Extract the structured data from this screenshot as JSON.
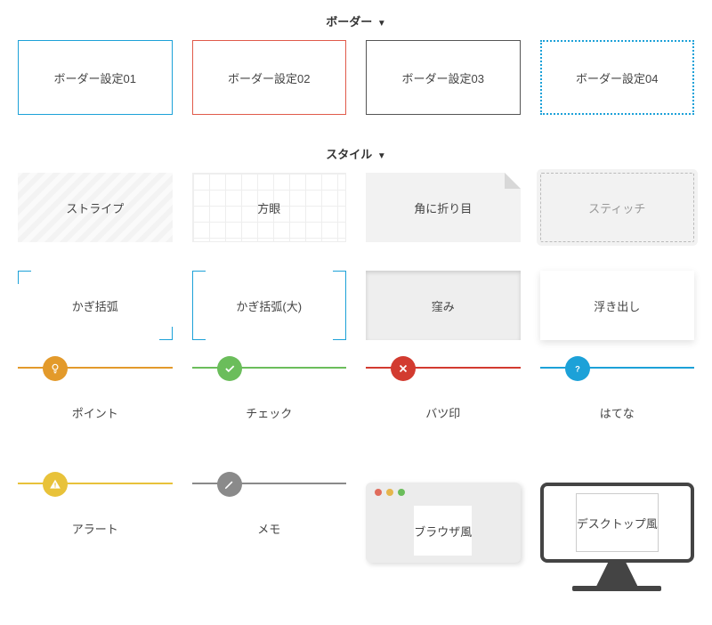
{
  "sections": {
    "border": {
      "title": "ボーダー"
    },
    "style": {
      "title": "スタイル"
    }
  },
  "border_items": [
    "ボーダー設定01",
    "ボーダー設定02",
    "ボーダー設定03",
    "ボーダー設定04"
  ],
  "style_items": {
    "stripe": "ストライプ",
    "graph": "方眼",
    "fold": "角に折り目",
    "stitch": "スティッチ",
    "bracket": "かぎ括弧",
    "bracketL": "かぎ括弧(大)",
    "sunken": "窪み",
    "raised": "浮き出し",
    "point": "ポイント",
    "check": "チェック",
    "batsu": "バツ印",
    "hatena": "はてな",
    "alert": "アラート",
    "memo": "メモ",
    "browser": "ブラウザ風",
    "desktop": "デスクトップ風"
  },
  "colors": {
    "point": "#e39a2b",
    "check": "#6bbd5b",
    "batsu": "#d23b30",
    "hatena": "#1ca1d8",
    "alert": "#e8c23a",
    "memo": "#8a8a8a"
  }
}
